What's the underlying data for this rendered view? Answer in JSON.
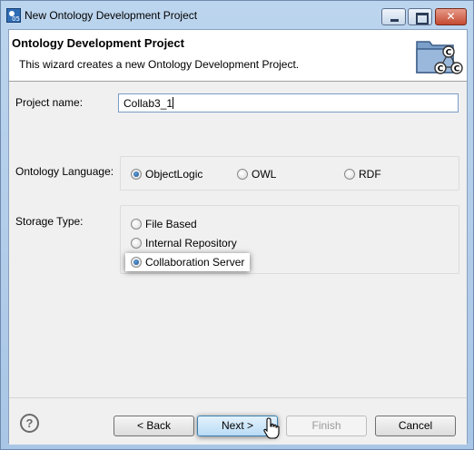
{
  "window": {
    "title": "New Ontology Development Project"
  },
  "banner": {
    "title": "Ontology Development Project",
    "description": "This wizard creates a new Ontology Development Project."
  },
  "form": {
    "project_name_label": "Project name:",
    "project_name_value": "Collab3_1",
    "ontology_language_label": "Ontology Language:",
    "languages": [
      "ObjectLogic",
      "OWL",
      "RDF"
    ],
    "selected_language": "ObjectLogic",
    "storage_type_label": "Storage Type:",
    "storage_types": [
      "File Based",
      "Internal Repository",
      "Collaboration Server"
    ],
    "selected_storage": "Collaboration Server"
  },
  "buttons": {
    "help": "?",
    "back": "< Back",
    "next": "Next >",
    "finish": "Finish",
    "cancel": "Cancel"
  }
}
